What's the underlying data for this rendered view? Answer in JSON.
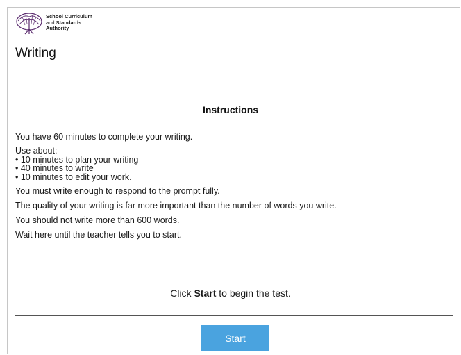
{
  "header": {
    "logo": {
      "line1": "School Curriculum",
      "line2_prefix": "and ",
      "line2_bold": "Standards",
      "line3": "Authority"
    },
    "title": "Writing"
  },
  "instructions": {
    "heading": "Instructions",
    "time_line": "You have 60 minutes to complete your writing.",
    "use_about": "Use about:",
    "bullets": [
      "• 10 minutes to plan your writing",
      "• 40 minutes to write",
      "• 10 minutes to edit your work."
    ],
    "respond_fully": "You must write enough to respond to the prompt fully.",
    "quality": "The quality of your writing is far more important than the number of words you write.",
    "word_limit": "You should not write more than 600 words.",
    "wait": "Wait here until the teacher tells you to start."
  },
  "prompt": {
    "before": "Click ",
    "bold": "Start",
    "after": " to begin the test."
  },
  "start_button": {
    "label": "Start",
    "color": "#4aa3df"
  }
}
